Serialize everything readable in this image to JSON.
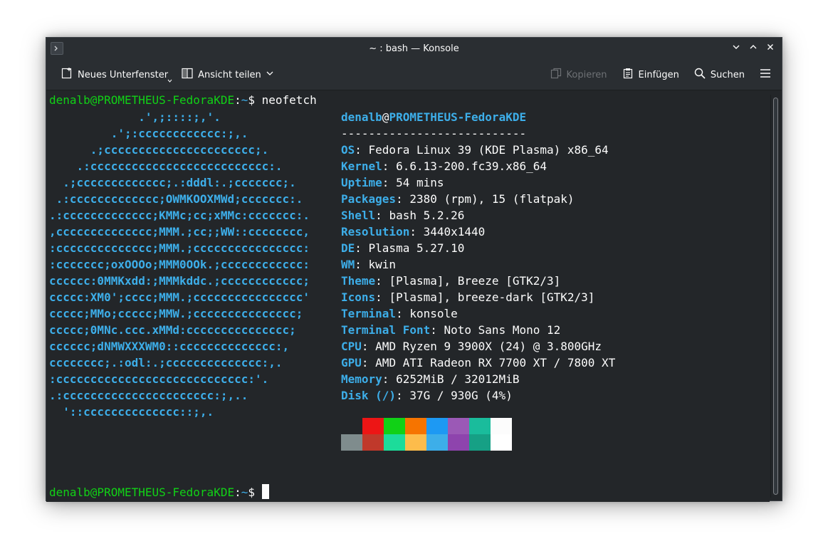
{
  "window": {
    "title": "~ : bash — Konsole"
  },
  "toolbar": {
    "new_tab": "Neues Unterfenster",
    "split_view": "Ansicht teilen",
    "copy": "Kopieren",
    "paste": "Einfügen",
    "search": "Suchen"
  },
  "terminal": {
    "prompt_user": "denalb@PROMETHEUS-FedoraKDE",
    "prompt_sep": ":",
    "prompt_dir": "~",
    "prompt_sym": "$ ",
    "command": "neofetch",
    "info": {
      "user": "denalb",
      "at": "@",
      "host": "PROMETHEUS-FedoraKDE",
      "separator": "---------------------------",
      "rows": [
        {
          "key": "OS",
          "value": ": Fedora Linux 39 (KDE Plasma) x86_64"
        },
        {
          "key": "Kernel",
          "value": ": 6.6.13-200.fc39.x86_64"
        },
        {
          "key": "Uptime",
          "value": ": 54 mins"
        },
        {
          "key": "Packages",
          "value": ": 2380 (rpm), 15 (flatpak)"
        },
        {
          "key": "Shell",
          "value": ": bash 5.2.26"
        },
        {
          "key": "Resolution",
          "value": ": 3440x1440"
        },
        {
          "key": "DE",
          "value": ": Plasma 5.27.10"
        },
        {
          "key": "WM",
          "value": ": kwin"
        },
        {
          "key": "Theme",
          "value": ": [Plasma], Breeze [GTK2/3]"
        },
        {
          "key": "Icons",
          "value": ": [Plasma], breeze-dark [GTK2/3]"
        },
        {
          "key": "Terminal",
          "value": ": konsole"
        },
        {
          "key": "Terminal Font",
          "value": ": Noto Sans Mono 12"
        },
        {
          "key": "CPU",
          "value": ": AMD Ryzen 9 3900X (24) @ 3.800GHz"
        },
        {
          "key": "GPU",
          "value": ": AMD ATI Radeon RX 7700 XT / 7800 XT"
        },
        {
          "key": "Memory",
          "value": ": 6252MiB / 32012MiB"
        },
        {
          "key": "Disk (/)",
          "value": ": 37G / 930G (4%)"
        }
      ]
    },
    "ascii_art": [
      "             .',;::::;,'.",
      "         .';:cccccccccccc:;,.",
      "      .;cccccccccccccccccccccc;.",
      "    .:cccccccccccccccccccccccccc:.",
      "  .;ccccccccccccc;.:dddl:.;ccccccc;.",
      " .:ccccccccccccc;OWMKOOXMWd;ccccccc:.",
      ".:ccccccccccccc;KMMc;cc;xMMc:ccccccc:.",
      ",cccccccccccccc;MMM.;cc;;WW::cccccccc,",
      ":cccccccccccccc;MMM.;cccccccccccccccc:",
      ":ccccccc;oxOOOo;MMM0OOk.;cccccccccccc:",
      "cccccc:0MMKxdd:;MMMkddc.;cccccccccccc;",
      "ccccc:XM0';cccc;MMM.;cccccccccccccccc'",
      "ccccc;MMo;ccccc;MMW.;ccccccccccccccc;",
      "ccccc;0MNc.ccc.xMMd:ccccccccccccccc;",
      "cccccc;dNMWXXXWM0::cccccccccccccc:,",
      "cccccccc;.:odl:.;cccccccccccccc:,.",
      ":cccccccccccccccccccccccccccc:'.",
      ".:cccccccccccccccccccccc:;,..",
      "  '::cccccccccccccc::;,."
    ],
    "palette_top": [
      "#232629",
      "#ed1515",
      "#11d116",
      "#f67400",
      "#1d99f3",
      "#9b59b6",
      "#1abc9c",
      "#fcfcfc"
    ],
    "palette_bottom": [
      "#7f8c8d",
      "#c0392b",
      "#1cdc9a",
      "#fdbc4b",
      "#3daee9",
      "#8e44ad",
      "#16a085",
      "#ffffff"
    ]
  }
}
